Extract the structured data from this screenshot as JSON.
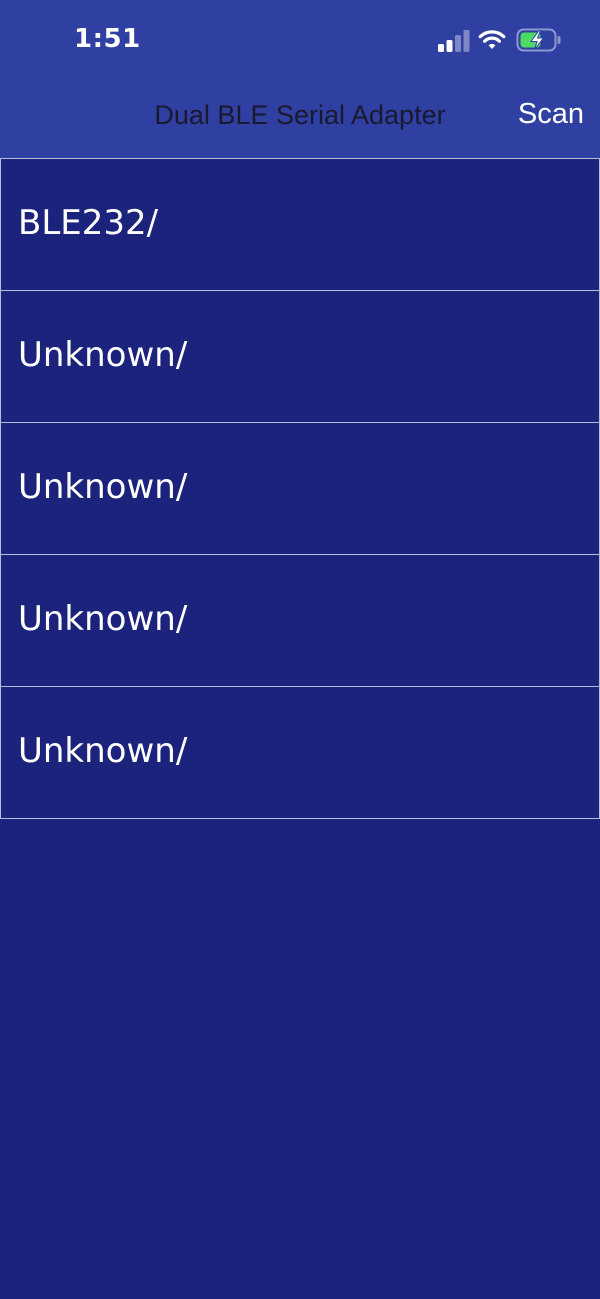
{
  "status_bar": {
    "time": "1:51",
    "signal_icon": "cellular-signal-icon",
    "wifi_icon": "wifi-icon",
    "battery_icon": "battery-charging-icon",
    "battery_color": "#4cd964"
  },
  "nav": {
    "title": "Dual BLE Serial Adapter",
    "scan_label": "Scan"
  },
  "devices": [
    {
      "label": "BLE232/"
    },
    {
      "label": "Unknown/"
    },
    {
      "label": "Unknown/"
    },
    {
      "label": "Unknown/"
    },
    {
      "label": "Unknown/"
    }
  ],
  "colors": {
    "header": "#2f3fa2",
    "background": "#1c237c",
    "divider": "#b8bcdc"
  }
}
